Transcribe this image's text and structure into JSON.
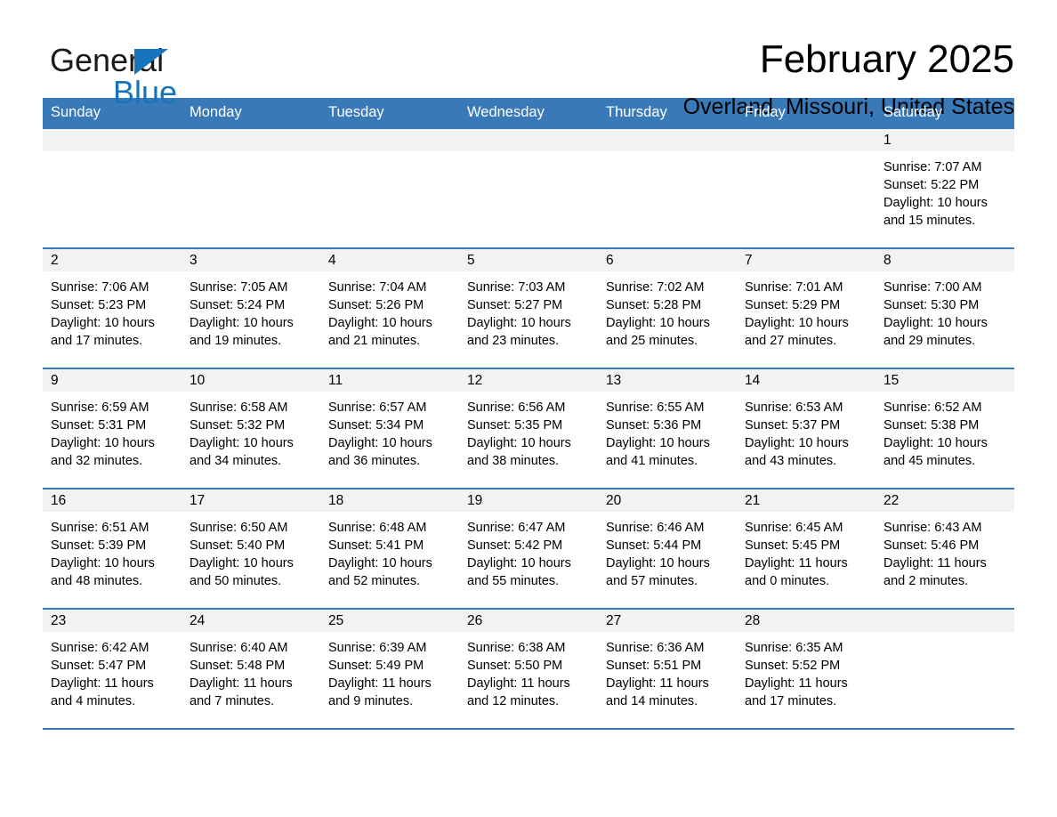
{
  "brand": {
    "name_part1": "General",
    "name_part2": "Blue",
    "triangle_color": "#1574bb",
    "blue_color": "#1574bb"
  },
  "header": {
    "title": "February 2025",
    "subtitle": "Overland, Missouri, United States"
  },
  "theme": {
    "header_blue": "#3a79b8",
    "day_bar_gray": "#f2f2f2",
    "text_black": "#000000",
    "header_text": "#ffffff"
  },
  "calendar": {
    "weekdays": [
      "Sunday",
      "Monday",
      "Tuesday",
      "Wednesday",
      "Thursday",
      "Friday",
      "Saturday"
    ],
    "weeks": [
      [
        {
          "day": "",
          "sunrise": "",
          "sunset": "",
          "daylight": ""
        },
        {
          "day": "",
          "sunrise": "",
          "sunset": "",
          "daylight": ""
        },
        {
          "day": "",
          "sunrise": "",
          "sunset": "",
          "daylight": ""
        },
        {
          "day": "",
          "sunrise": "",
          "sunset": "",
          "daylight": ""
        },
        {
          "day": "",
          "sunrise": "",
          "sunset": "",
          "daylight": ""
        },
        {
          "day": "",
          "sunrise": "",
          "sunset": "",
          "daylight": ""
        },
        {
          "day": "1",
          "sunrise": "Sunrise: 7:07 AM",
          "sunset": "Sunset: 5:22 PM",
          "daylight": "Daylight: 10 hours and 15 minutes."
        }
      ],
      [
        {
          "day": "2",
          "sunrise": "Sunrise: 7:06 AM",
          "sunset": "Sunset: 5:23 PM",
          "daylight": "Daylight: 10 hours and 17 minutes."
        },
        {
          "day": "3",
          "sunrise": "Sunrise: 7:05 AM",
          "sunset": "Sunset: 5:24 PM",
          "daylight": "Daylight: 10 hours and 19 minutes."
        },
        {
          "day": "4",
          "sunrise": "Sunrise: 7:04 AM",
          "sunset": "Sunset: 5:26 PM",
          "daylight": "Daylight: 10 hours and 21 minutes."
        },
        {
          "day": "5",
          "sunrise": "Sunrise: 7:03 AM",
          "sunset": "Sunset: 5:27 PM",
          "daylight": "Daylight: 10 hours and 23 minutes."
        },
        {
          "day": "6",
          "sunrise": "Sunrise: 7:02 AM",
          "sunset": "Sunset: 5:28 PM",
          "daylight": "Daylight: 10 hours and 25 minutes."
        },
        {
          "day": "7",
          "sunrise": "Sunrise: 7:01 AM",
          "sunset": "Sunset: 5:29 PM",
          "daylight": "Daylight: 10 hours and 27 minutes."
        },
        {
          "day": "8",
          "sunrise": "Sunrise: 7:00 AM",
          "sunset": "Sunset: 5:30 PM",
          "daylight": "Daylight: 10 hours and 29 minutes."
        }
      ],
      [
        {
          "day": "9",
          "sunrise": "Sunrise: 6:59 AM",
          "sunset": "Sunset: 5:31 PM",
          "daylight": "Daylight: 10 hours and 32 minutes."
        },
        {
          "day": "10",
          "sunrise": "Sunrise: 6:58 AM",
          "sunset": "Sunset: 5:32 PM",
          "daylight": "Daylight: 10 hours and 34 minutes."
        },
        {
          "day": "11",
          "sunrise": "Sunrise: 6:57 AM",
          "sunset": "Sunset: 5:34 PM",
          "daylight": "Daylight: 10 hours and 36 minutes."
        },
        {
          "day": "12",
          "sunrise": "Sunrise: 6:56 AM",
          "sunset": "Sunset: 5:35 PM",
          "daylight": "Daylight: 10 hours and 38 minutes."
        },
        {
          "day": "13",
          "sunrise": "Sunrise: 6:55 AM",
          "sunset": "Sunset: 5:36 PM",
          "daylight": "Daylight: 10 hours and 41 minutes."
        },
        {
          "day": "14",
          "sunrise": "Sunrise: 6:53 AM",
          "sunset": "Sunset: 5:37 PM",
          "daylight": "Daylight: 10 hours and 43 minutes."
        },
        {
          "day": "15",
          "sunrise": "Sunrise: 6:52 AM",
          "sunset": "Sunset: 5:38 PM",
          "daylight": "Daylight: 10 hours and 45 minutes."
        }
      ],
      [
        {
          "day": "16",
          "sunrise": "Sunrise: 6:51 AM",
          "sunset": "Sunset: 5:39 PM",
          "daylight": "Daylight: 10 hours and 48 minutes."
        },
        {
          "day": "17",
          "sunrise": "Sunrise: 6:50 AM",
          "sunset": "Sunset: 5:40 PM",
          "daylight": "Daylight: 10 hours and 50 minutes."
        },
        {
          "day": "18",
          "sunrise": "Sunrise: 6:48 AM",
          "sunset": "Sunset: 5:41 PM",
          "daylight": "Daylight: 10 hours and 52 minutes."
        },
        {
          "day": "19",
          "sunrise": "Sunrise: 6:47 AM",
          "sunset": "Sunset: 5:42 PM",
          "daylight": "Daylight: 10 hours and 55 minutes."
        },
        {
          "day": "20",
          "sunrise": "Sunrise: 6:46 AM",
          "sunset": "Sunset: 5:44 PM",
          "daylight": "Daylight: 10 hours and 57 minutes."
        },
        {
          "day": "21",
          "sunrise": "Sunrise: 6:45 AM",
          "sunset": "Sunset: 5:45 PM",
          "daylight": "Daylight: 11 hours and 0 minutes."
        },
        {
          "day": "22",
          "sunrise": "Sunrise: 6:43 AM",
          "sunset": "Sunset: 5:46 PM",
          "daylight": "Daylight: 11 hours and 2 minutes."
        }
      ],
      [
        {
          "day": "23",
          "sunrise": "Sunrise: 6:42 AM",
          "sunset": "Sunset: 5:47 PM",
          "daylight": "Daylight: 11 hours and 4 minutes."
        },
        {
          "day": "24",
          "sunrise": "Sunrise: 6:40 AM",
          "sunset": "Sunset: 5:48 PM",
          "daylight": "Daylight: 11 hours and 7 minutes."
        },
        {
          "day": "25",
          "sunrise": "Sunrise: 6:39 AM",
          "sunset": "Sunset: 5:49 PM",
          "daylight": "Daylight: 11 hours and 9 minutes."
        },
        {
          "day": "26",
          "sunrise": "Sunrise: 6:38 AM",
          "sunset": "Sunset: 5:50 PM",
          "daylight": "Daylight: 11 hours and 12 minutes."
        },
        {
          "day": "27",
          "sunrise": "Sunrise: 6:36 AM",
          "sunset": "Sunset: 5:51 PM",
          "daylight": "Daylight: 11 hours and 14 minutes."
        },
        {
          "day": "28",
          "sunrise": "Sunrise: 6:35 AM",
          "sunset": "Sunset: 5:52 PM",
          "daylight": "Daylight: 11 hours and 17 minutes."
        },
        {
          "day": "",
          "sunrise": "",
          "sunset": "",
          "daylight": ""
        }
      ]
    ]
  }
}
